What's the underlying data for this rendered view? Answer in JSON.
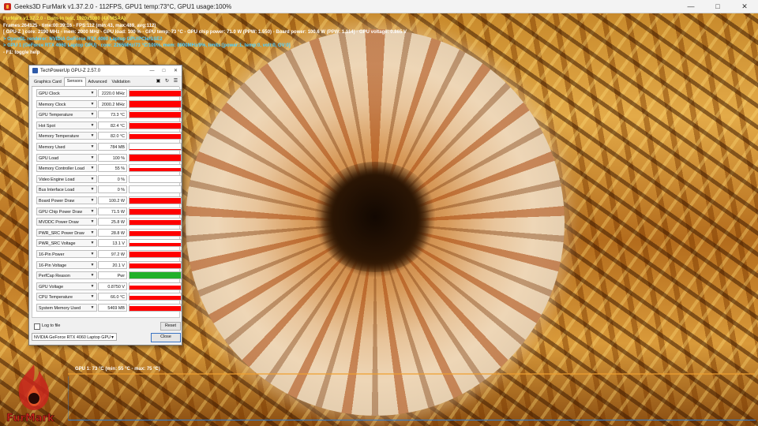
{
  "window": {
    "title": "Geeks3D FurMark v1.37.2.0 - 112FPS, GPU1 temp:73°C, GPU1 usage:100%"
  },
  "hud": {
    "line1": "FurMark v1.37.2.0 - Burn-in test, 1920x1080 (4X MSAA)",
    "line2": "Frames:264125 - time:00:39:16 - FPS:112 (min:43, max:489, avg:112)",
    "line3": "[ GPU-Z ] core: 2190 MHz - mem: 2000 MHz - GPU load: 100 % - GPU temp: 73 °C - GPU chip power: 71.0 W (PPW: 1.550) - Board power: 100.6 W (PPW: 1.114) - GPU voltage: 0.865 V",
    "line4": "> OpenGL renderer: NVIDIA GeForce RTX 4060 Laptop GPU/PCIe/SSE2",
    "line5": "> GPU 1 (GeForce RTX 4060 Laptop GPU) - core: 2265MHz/73 °C/100%, mem: 8000MHz/9%, limits:[power:1, temp:0, volt:0, OV:0]",
    "line6": "- F1: toggle help"
  },
  "gpuz": {
    "title": "TechPowerUp GPU-Z 2.57.0",
    "tabs": [
      "Graphics Card",
      "Sensors",
      "Advanced",
      "Validation"
    ],
    "active_tab": "Sensors",
    "sensors": [
      {
        "label": "GPU Clock",
        "value": "2220.0 MHz",
        "fill": 0.92,
        "color": "#ff0000"
      },
      {
        "label": "Memory Clock",
        "value": "2000.2 MHz",
        "fill": 0.95,
        "color": "#ff0000"
      },
      {
        "label": "GPU Temperature",
        "value": "73.3 °C",
        "fill": 0.85,
        "color": "#ff0000"
      },
      {
        "label": "Hot Spot",
        "value": "82.4 °C",
        "fill": 0.88,
        "color": "#ff0000"
      },
      {
        "label": "Memory Temperature",
        "value": "82.0 °C",
        "fill": 0.82,
        "color": "#ff0000"
      },
      {
        "label": "Memory Used",
        "value": "784 MB",
        "fill": 0.08,
        "color": "#ff0000"
      },
      {
        "label": "GPU Load",
        "value": "100 %",
        "fill": 0.95,
        "color": "#ff0000"
      },
      {
        "label": "Memory Controller Load",
        "value": "55 %",
        "fill": 0.55,
        "color": "#ff0000"
      },
      {
        "label": "Video Engine Load",
        "value": "0 %",
        "fill": 0,
        "color": "#ff0000"
      },
      {
        "label": "Bus Interface Load",
        "value": "0 %",
        "fill": 0,
        "color": "#ff0000"
      },
      {
        "label": "Board Power Draw",
        "value": "100.2 W",
        "fill": 0.85,
        "color": "#ff0000"
      },
      {
        "label": "GPU Chip Power Draw",
        "value": "71.5 W",
        "fill": 0.8,
        "color": "#ff0000"
      },
      {
        "label": "MVDDC Power Draw",
        "value": "25.8 W",
        "fill": 0.75,
        "color": "#ff0000"
      },
      {
        "label": "PWR_SRC Power Draw",
        "value": "28.8 W",
        "fill": 0.78,
        "color": "#ff0000"
      },
      {
        "label": "PWR_SRC Voltage",
        "value": "13.1 V",
        "fill": 0.6,
        "color": "#ff0000"
      },
      {
        "label": "16-Pin Power",
        "value": "97.2 W",
        "fill": 0.82,
        "color": "#ff0000"
      },
      {
        "label": "16-Pin Voltage",
        "value": "20.1 V",
        "fill": 0.7,
        "color": "#ff0000"
      },
      {
        "label": "PerfCap Reason",
        "value": "Pwr",
        "fill": 1.0,
        "color": "#22b02a"
      },
      {
        "label": "GPU Voltage",
        "value": "0.8750 V",
        "fill": 0.6,
        "color": "#ff0000"
      },
      {
        "label": "CPU Temperature",
        "value": "66.0 °C",
        "fill": 0.7,
        "color": "#ff0000"
      },
      {
        "label": "System Memory Used",
        "value": "5469 MB",
        "fill": 0.7,
        "color": "#ff0000"
      }
    ],
    "log_to_file": "Log to file",
    "reset": "Reset",
    "gpu_select": "NVIDIA GeForce RTX 4060 Laptop GPU",
    "close": "Close"
  },
  "graph": {
    "caption": "GPU 1: 73 °C (min: 55 °C - max: 75 °C)"
  },
  "logo_text": "FurMark",
  "colors": {
    "hud_title": "#f5e94a",
    "hud_info": "#4fd1ff",
    "graph_line": "#f0a030",
    "bar_red": "#ff0000",
    "bar_green": "#22b02a"
  }
}
